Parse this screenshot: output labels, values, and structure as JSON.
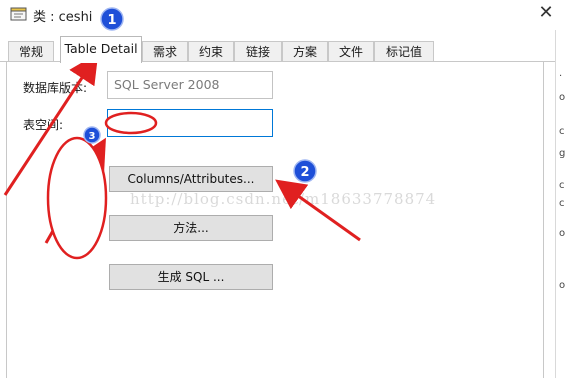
{
  "window": {
    "title": "类 : ceshi",
    "close_glyph": "✕",
    "icon": "class-window-icon"
  },
  "tabs": [
    {
      "label": "常规",
      "active": false
    },
    {
      "label": "Table Detail",
      "active": true
    },
    {
      "label": "需求",
      "active": false
    },
    {
      "label": "约束",
      "active": false
    },
    {
      "label": "链接",
      "active": false
    },
    {
      "label": "方案",
      "active": false
    },
    {
      "label": "文件",
      "active": false
    },
    {
      "label": "标记值",
      "active": false
    }
  ],
  "form": {
    "db_version_label": "数据库版本:",
    "db_version_value": "SQL Server 2008",
    "tablespace_label": "表空间:",
    "tablespace_value": ""
  },
  "buttons": {
    "columns": "Columns/Attributes...",
    "methods": "方法...",
    "generate_sql": "生成 SQL ..."
  },
  "side_strip_chars": [
    ".",
    "o",
    "c",
    "g",
    "c",
    "c",
    "o",
    "o"
  ],
  "watermark": "http://blog.csdn.net/m18633778874",
  "annotations": {
    "marker_1": "1",
    "marker_2": "2",
    "marker_3": "3",
    "color": "#e02020",
    "marker_fill": "#1e4fd8"
  }
}
